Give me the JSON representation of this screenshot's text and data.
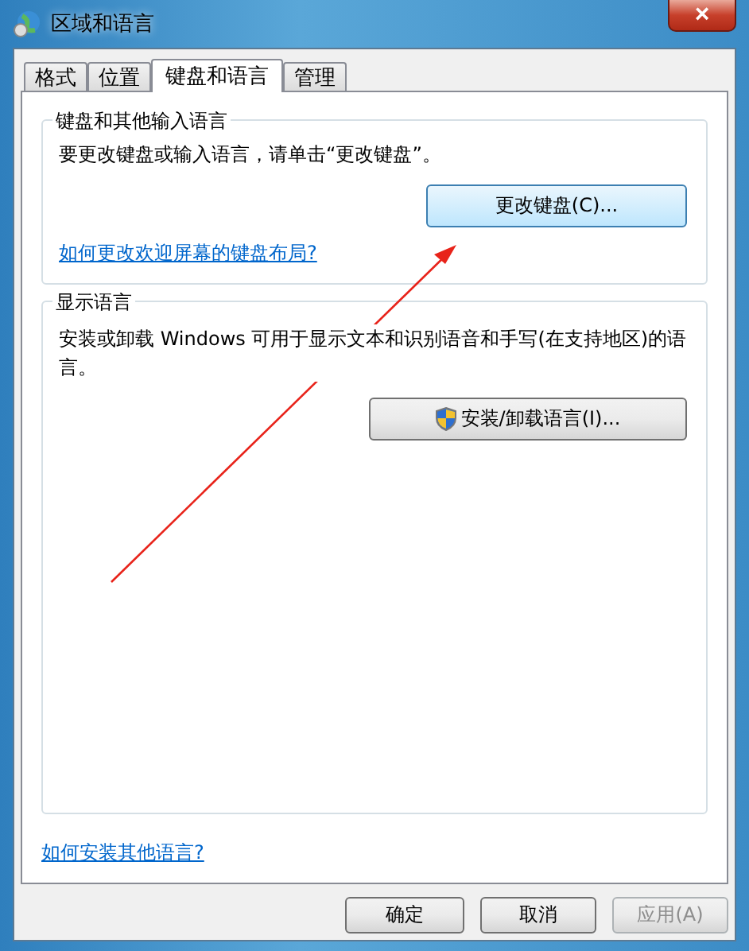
{
  "window": {
    "title": "区域和语言",
    "close": "×"
  },
  "tabs": [
    {
      "label": "格式",
      "selected": false
    },
    {
      "label": "位置",
      "selected": false
    },
    {
      "label": "键盘和语言",
      "selected": true
    },
    {
      "label": "管理",
      "selected": false
    }
  ],
  "keyboard_group": {
    "title": "键盘和其他输入语言",
    "text": "要更改键盘或输入语言，请单击“更改键盘”。",
    "button": "更改键盘(C)...",
    "link": "如何更改欢迎屏幕的键盘布局?"
  },
  "display_group": {
    "title": "显示语言",
    "text": "安装或卸载 Windows 可用于显示文本和识别语音和手写(在支持地区)的语言。",
    "button": "安装/卸载语言(I)..."
  },
  "footer_link": "如何安装其他语言?",
  "buttons": [
    {
      "label": "确定",
      "disabled": false
    },
    {
      "label": "取消",
      "disabled": false
    },
    {
      "label": "应用(A)",
      "disabled": true
    }
  ]
}
